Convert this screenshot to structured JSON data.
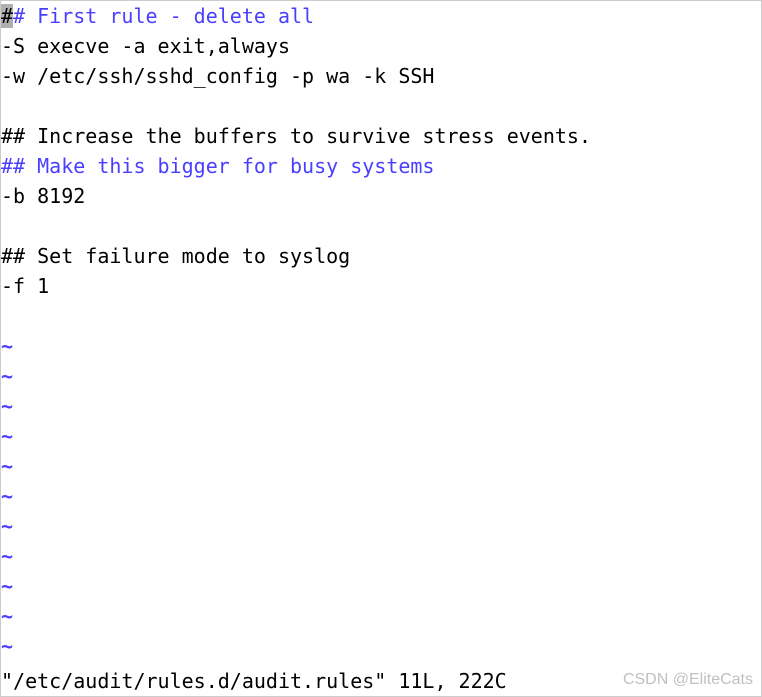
{
  "editor": {
    "lines": [
      {
        "segments": [
          {
            "text": "#",
            "class": "cursor-highlight"
          },
          {
            "text": "# First rule - delete all",
            "class": "comment"
          }
        ]
      },
      {
        "segments": [
          {
            "text": "-S execve -a exit,always",
            "class": "normal"
          }
        ]
      },
      {
        "segments": [
          {
            "text": "-w /etc/ssh/sshd_config -p wa -k SSH",
            "class": "normal"
          }
        ]
      },
      {
        "segments": [
          {
            "text": " ",
            "class": "normal"
          }
        ]
      },
      {
        "segments": [
          {
            "text": "## Increase the buffers to survive stress events.",
            "class": "normal"
          }
        ]
      },
      {
        "segments": [
          {
            "text": "## Make this bigger for busy systems",
            "class": "comment"
          }
        ]
      },
      {
        "segments": [
          {
            "text": "-b 8192",
            "class": "normal"
          }
        ]
      },
      {
        "segments": [
          {
            "text": " ",
            "class": "normal"
          }
        ]
      },
      {
        "segments": [
          {
            "text": "## Set failure mode to syslog",
            "class": "normal"
          }
        ]
      },
      {
        "segments": [
          {
            "text": "-f 1",
            "class": "normal"
          }
        ]
      }
    ],
    "tilde_lines": 12
  },
  "status": {
    "text": "\"/etc/audit/rules.d/audit.rules\" 11L, 222C"
  },
  "watermark": {
    "text": "CSDN @EliteCats"
  }
}
